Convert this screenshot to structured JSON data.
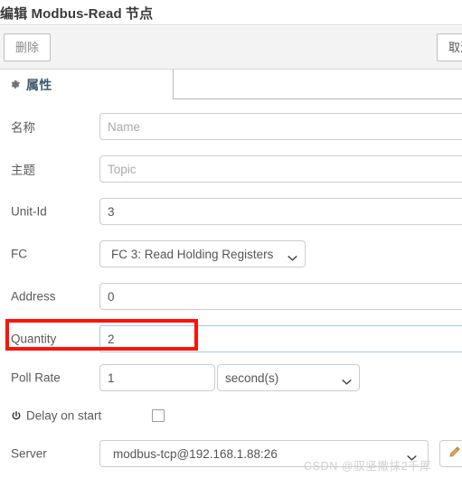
{
  "header": {
    "title": "编辑 Modbus-Read 节点"
  },
  "toolbar": {
    "delete_label": "删除",
    "cancel_label": "取消"
  },
  "tabs": [
    {
      "label": "属性",
      "icon": "gear-icon",
      "active": true
    }
  ],
  "form": {
    "rows": [
      {
        "label": "名称",
        "value": "",
        "placeholder": "Name",
        "type": "text"
      },
      {
        "label": "主题",
        "value": "",
        "placeholder": "Topic",
        "type": "text"
      },
      {
        "label": "Unit-Id",
        "value": "3",
        "placeholder": "",
        "type": "text"
      },
      {
        "label": "FC",
        "value": "FC 3: Read Holding Registers",
        "placeholder": "",
        "type": "select"
      },
      {
        "label": "Address",
        "value": "0",
        "placeholder": "",
        "type": "text"
      },
      {
        "label": "Quantity",
        "value": "2",
        "placeholder": "",
        "type": "text"
      },
      {
        "label": "Poll Rate",
        "value": "1",
        "placeholder": "",
        "type": "text"
      },
      {
        "label": "Delay on start",
        "value": "",
        "placeholder": "",
        "type": "checkbox"
      },
      {
        "label": "Server",
        "value": "modbus-tcp@192.168.1.88:26",
        "placeholder": "",
        "type": "select"
      }
    ],
    "poll_rate_unit": "second(s)",
    "server_edit_icon": "pencil-icon",
    "delay_on_start_icon": "power-icon",
    "delay_on_start_checked": false
  },
  "annotation": {
    "shape": "rectangle",
    "color": "#fb1405",
    "targets": "quantity-row"
  },
  "watermark": {
    "text": "CSDN @驭坚撤抹2千厍"
  },
  "colors": {
    "accent_blue": "#3f5a70",
    "annotation_red": "#fb1405",
    "focus_border": "#a5c8ea",
    "toolbar_bg": "#f3f3f3",
    "border_gray": "#cccccc",
    "pencil_orange": "#d99b4e"
  }
}
